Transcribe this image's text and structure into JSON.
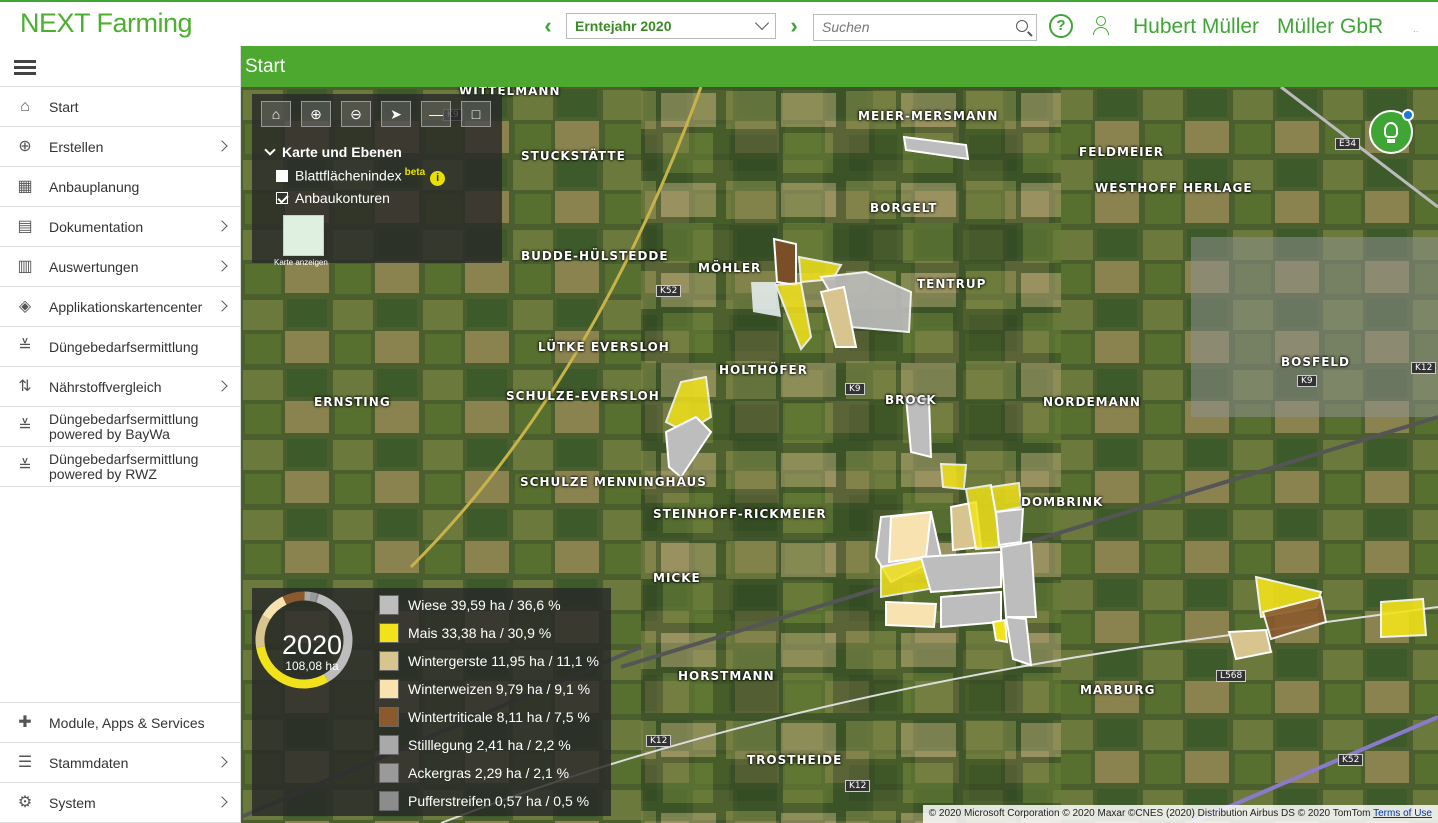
{
  "app": {
    "logo": "NEXT Farming",
    "year_select": "Erntejahr 2020",
    "search_placeholder": "Suchen",
    "help": "?",
    "user_name": "Hubert Müller",
    "company": "Müller GbR",
    "more": ".."
  },
  "sidebar": {
    "items": [
      {
        "label": "Start",
        "icon": "home-icon",
        "arrow": false
      },
      {
        "label": "Erstellen",
        "icon": "plus-circle-icon",
        "arrow": true
      },
      {
        "label": "Anbauplanung",
        "icon": "planning-icon",
        "arrow": false
      },
      {
        "label": "Dokumentation",
        "icon": "clipboard-icon",
        "arrow": true
      },
      {
        "label": "Auswertungen",
        "icon": "bar-chart-icon",
        "arrow": true
      },
      {
        "label": "Applikationskartencenter",
        "icon": "map-pin-icon",
        "arrow": true
      },
      {
        "label": "Düngebedarfsermittlung",
        "icon": "fertilizer-icon",
        "arrow": false
      },
      {
        "label": "Nährstoffvergleich",
        "icon": "compare-arrows-icon",
        "arrow": true
      },
      {
        "label": "Düngebedarfsermittlung",
        "sub": "powered by BayWa",
        "icon": "fertilizer-icon",
        "arrow": false
      },
      {
        "label": "Düngebedarfsermittlung",
        "sub": "powered by RWZ",
        "icon": "fertilizer-icon",
        "arrow": false
      }
    ],
    "bottom": [
      {
        "label": "Module, Apps & Services",
        "icon": "puzzle-icon",
        "arrow": false
      },
      {
        "label": "Stammdaten",
        "icon": "database-icon",
        "arrow": true
      },
      {
        "label": "System",
        "icon": "gear-icon",
        "arrow": true
      }
    ]
  },
  "page": {
    "title": "Start"
  },
  "map": {
    "layers_title": "Karte und Ebenen",
    "layer_lai": "Blattflächenindex",
    "layer_lai_badge": "beta",
    "layer_contours": "Anbaukonturen",
    "show_map": "Karte anzeigen",
    "places": [
      "WITTELMANN",
      "MEIER-MERSMANN",
      "FELDMEIER",
      "STUCKSTÄTTE",
      "BORGELT",
      "WESTHOFF HERLAGE",
      "BUDDE-HÜLSTEDDE",
      "MÖHLER",
      "TENTRUP",
      "LÜTKE EVERSLOH",
      "HOLTHÖFER",
      "BOSFELD",
      "SCHULZE-EVERSLOH",
      "ERNSTING",
      "BROCK",
      "NORDEMANN",
      "SCHULZE MENNINGHAUS",
      "DOMBRINK",
      "STEINHOFF-RICKMEIER",
      "MICKE",
      "HORSTMANN",
      "MARBURG",
      "TROSTHEIDE"
    ],
    "roads": [
      "K9",
      "K52",
      "K9",
      "K9",
      "K12",
      "K12",
      "K12",
      "L568",
      "E34",
      "K52"
    ],
    "attribution": "© 2020 Microsoft Corporation © 2020 Maxar ©CNES (2020) Distribution Airbus DS © 2020 TomTom",
    "terms": "Terms of Use"
  },
  "crop_summary": {
    "year": "2020",
    "total": "108,08 ha",
    "items": [
      {
        "label": "Wiese 39,59 ha / 36,6 %",
        "color": "#bdbdbd",
        "share": 36.6
      },
      {
        "label": "Mais 33,38 ha / 30,9 %",
        "color": "#f2e21b",
        "share": 30.9
      },
      {
        "label": "Wintergerste 11,95 ha / 11,1 %",
        "color": "#d8c48e",
        "share": 11.1
      },
      {
        "label": "Winterweizen 9,79 ha / 9,1 %",
        "color": "#f7e2b0",
        "share": 9.1
      },
      {
        "label": "Wintertriticale 8,11 ha / 7,5 %",
        "color": "#8a5a2e",
        "share": 7.5
      },
      {
        "label": "Stilllegung 2,41 ha / 2,2 %",
        "color": "#a9a9a9",
        "share": 2.2
      },
      {
        "label": "Ackergras 2,29 ha / 2,1 %",
        "color": "#9a9a9a",
        "share": 2.1
      },
      {
        "label": "Pufferstreifen 0,57 ha / 0,5 %",
        "color": "#8c8c8c",
        "share": 0.5
      }
    ]
  }
}
